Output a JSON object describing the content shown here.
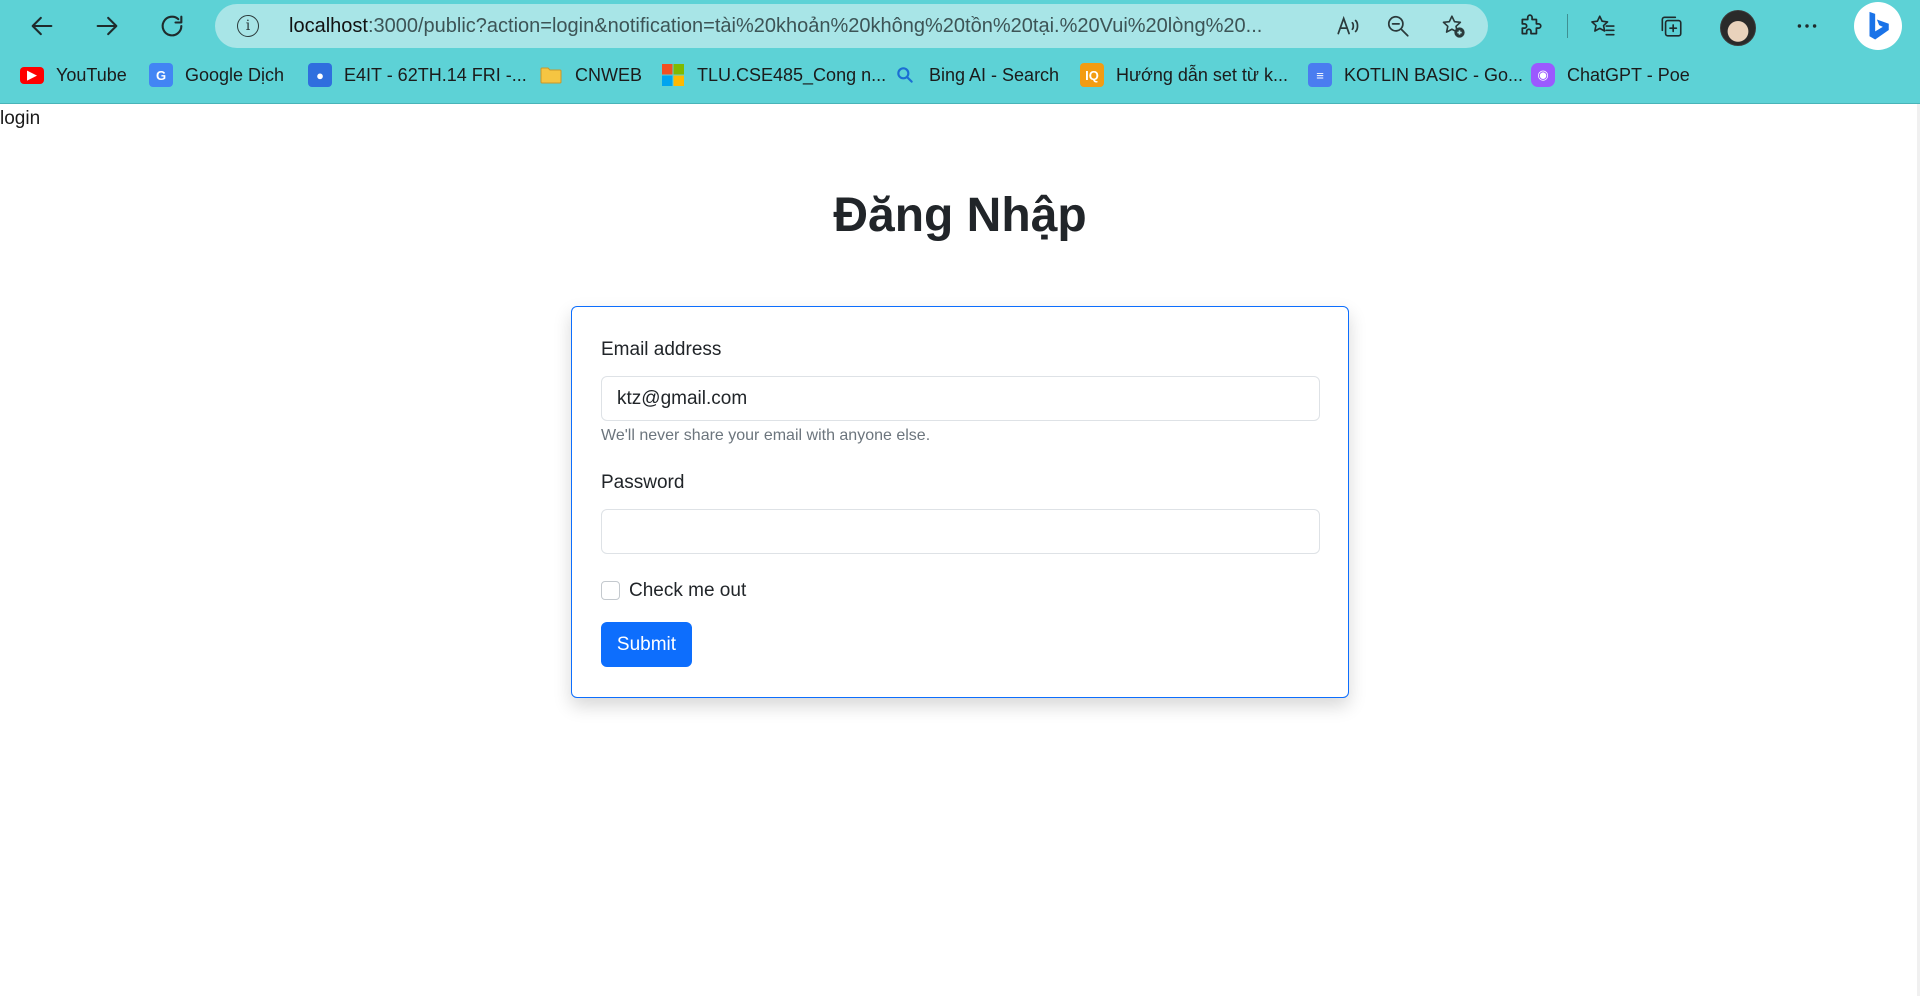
{
  "browser": {
    "url_host": "localhost",
    "url_rest": ":3000/public?action=login&notification=tài%20khoản%20không%20tồn%20tại.%20Vui%20lòng%20...",
    "bookmarks": [
      {
        "label": "YouTube",
        "icon": "youtube-icon",
        "color": "#ff0000"
      },
      {
        "label": "Google Dịch",
        "icon": "google-translate-icon",
        "color": "#4285f4"
      },
      {
        "label": "E4IT - 62TH.14 FRI -...",
        "icon": "classroom-icon",
        "color": "#2f6fde"
      },
      {
        "label": "CNWEB",
        "icon": "folder-icon",
        "color": "#f5c542"
      },
      {
        "label": "TLU.CSE485_Cong n...",
        "icon": "microsoft-icon",
        "color": "#f25022"
      },
      {
        "label": "Bing AI - Search",
        "icon": "search-icon",
        "color": "#1b6ed4"
      },
      {
        "label": "Hướng dẫn set từ k...",
        "icon": "iq-icon",
        "color": "#f39c12"
      },
      {
        "label": "KOTLIN BASIC - Go...",
        "icon": "docs-icon",
        "color": "#4a7df0"
      },
      {
        "label": "ChatGPT - Poe",
        "icon": "poe-icon",
        "color": "#9b59ff"
      }
    ]
  },
  "page": {
    "top_label": "login",
    "heading": "Đăng Nhập",
    "form": {
      "email_label": "Email address",
      "email_value": "ktz@gmail.com",
      "email_help": "We'll never share your email with anyone else.",
      "password_label": "Password",
      "password_value": "",
      "checkbox_label": "Check me out",
      "checkbox_checked": false,
      "submit_label": "Submit"
    }
  },
  "colors": {
    "chrome": "#5dd2d6",
    "primary": "#0d6efd"
  }
}
